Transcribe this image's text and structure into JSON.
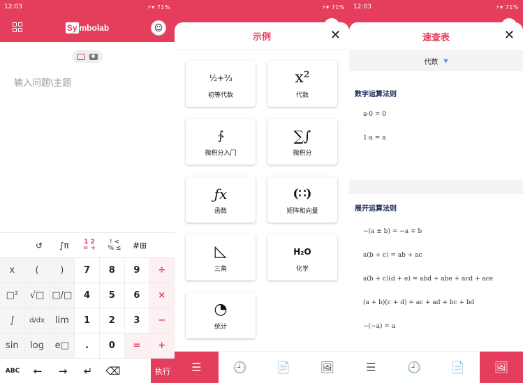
{
  "status": {
    "time": "12:03",
    "icons": "⚡▾ 71%"
  },
  "screen1": {
    "logo_box": "Sy",
    "logo_rest": "mbolab",
    "placeholder": "输入问题\\主题",
    "kb_tabs": [
      "↺",
      "∫π",
      "1 2\n= +",
      "! <\n% ≤",
      "#⊞"
    ],
    "rows": [
      [
        "x",
        "(",
        ")",
        "7",
        "8",
        "9",
        "÷"
      ],
      [
        "□²",
        "√□",
        "□/□",
        "4",
        "5",
        "6",
        "×"
      ],
      [
        "∫",
        "d/dx",
        "lim",
        "1",
        "2",
        "3",
        "−"
      ],
      [
        "sin",
        "log",
        "e□",
        ".",
        "0",
        "=",
        "+"
      ]
    ],
    "bottom": [
      "ABC",
      "←",
      "→",
      "↵",
      "⌫"
    ],
    "exec_label": "执行"
  },
  "screen2": {
    "title": "示例",
    "close": "✕",
    "cards": [
      {
        "glyph": "½+⅔",
        "label": "初等代数"
      },
      {
        "glyph": "x²",
        "label": "代数"
      },
      {
        "glyph": "∱",
        "label": "微积分入门"
      },
      {
        "glyph": "∑∫",
        "label": "微积分"
      },
      {
        "glyph": "ƒx",
        "label": "函数"
      },
      {
        "glyph": "(∷)",
        "label": "矩阵和向量"
      },
      {
        "glyph": "◺",
        "label": "三角"
      },
      {
        "glyph": "H₂O",
        "label": "化学"
      },
      {
        "glyph": "◔",
        "label": "统计"
      }
    ],
    "tabs": [
      "☰",
      "🕘",
      "📄",
      "🖼"
    ]
  },
  "screen3": {
    "title": "速查表",
    "close": "✕",
    "dropdown": "代数",
    "section1": "数字运算法则",
    "formulas1": [
      "a·0 = 0",
      "1·a = a"
    ],
    "section2": "展开运算法则",
    "formulas2": [
      "−(a ± b) = −a ∓ b",
      "a(b + c) = ab + ac",
      "a(b + c)(d + e) = abd + abe + acd + ace",
      "(a + b)(c + d) = ac + ad + bc + bd",
      "−(−a) = a"
    ],
    "tabs": [
      "☰",
      "🕘",
      "📄",
      "🖼"
    ]
  }
}
